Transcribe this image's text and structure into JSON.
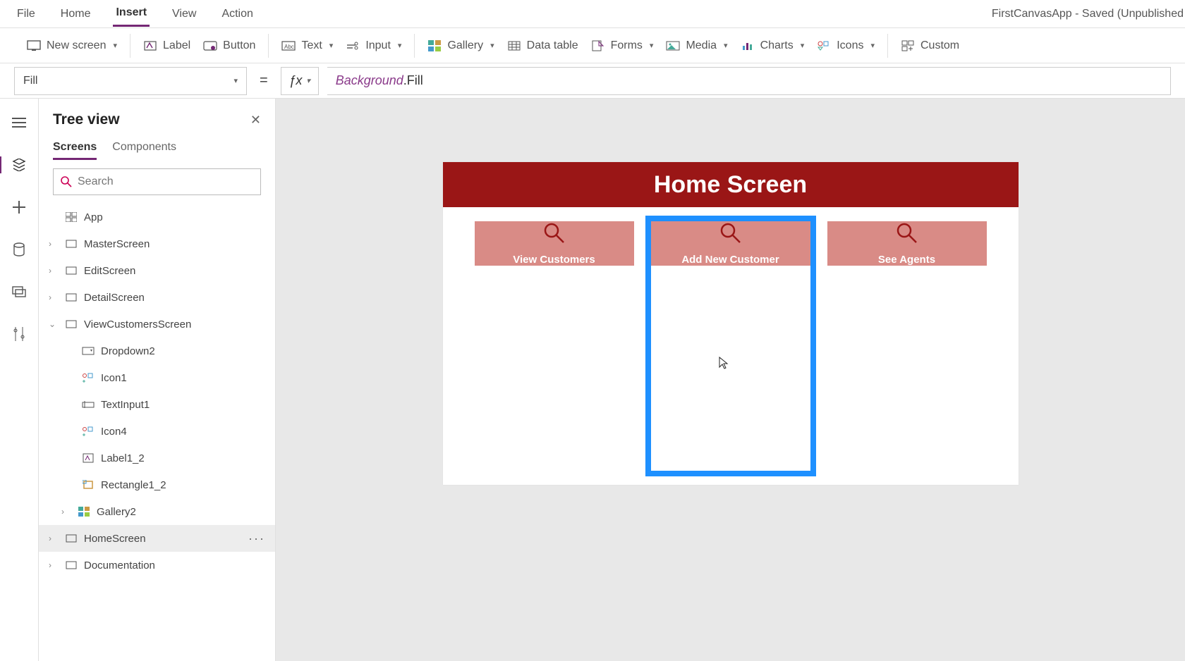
{
  "menubar": {
    "items": [
      "File",
      "Home",
      "Insert",
      "View",
      "Action"
    ],
    "active": "Insert",
    "app_title": "FirstCanvasApp - Saved (Unpublished"
  },
  "ribbon": {
    "new_screen": "New screen",
    "label": "Label",
    "button": "Button",
    "text": "Text",
    "input": "Input",
    "gallery": "Gallery",
    "data_table": "Data table",
    "forms": "Forms",
    "media": "Media",
    "charts": "Charts",
    "icons": "Icons",
    "custom": "Custom"
  },
  "formula": {
    "property": "Fill",
    "identifier": "Background",
    "member": ".Fill"
  },
  "tree": {
    "title": "Tree view",
    "tabs": [
      "Screens",
      "Components"
    ],
    "active_tab": "Screens",
    "search_placeholder": "Search",
    "app_label": "App",
    "items": [
      {
        "label": "MasterScreen"
      },
      {
        "label": "EditScreen"
      },
      {
        "label": "DetailScreen"
      },
      {
        "label": "ViewCustomersScreen"
      },
      {
        "label": "Dropdown2"
      },
      {
        "label": "Icon1"
      },
      {
        "label": "TextInput1"
      },
      {
        "label": "Icon4"
      },
      {
        "label": "Label1_2"
      },
      {
        "label": "Rectangle1_2"
      },
      {
        "label": "Gallery2"
      },
      {
        "label": "HomeScreen"
      },
      {
        "label": "Documentation"
      }
    ]
  },
  "canvas": {
    "header": "Home Screen",
    "cards": [
      {
        "label": "View Customers"
      },
      {
        "label": "Add New Customer"
      },
      {
        "label": "See Agents"
      }
    ]
  }
}
